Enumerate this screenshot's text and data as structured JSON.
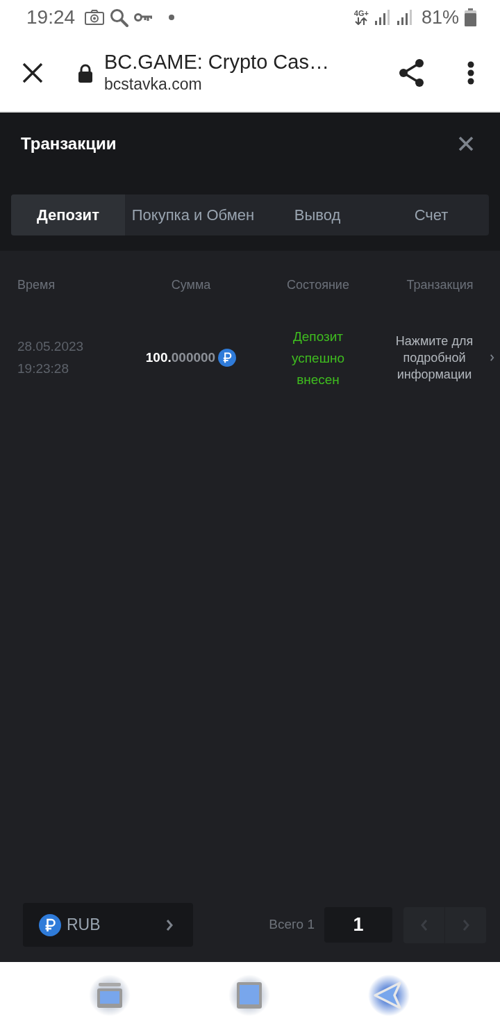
{
  "status_bar": {
    "time": "19:24",
    "network": "4G+",
    "battery": "81%"
  },
  "browser_bar": {
    "title": "BC.GAME: Crypto Cas…",
    "url": "bcstavka.com"
  },
  "dialog": {
    "title": "Транзакции",
    "tabs": [
      {
        "label": "Депозит",
        "selected": true
      },
      {
        "label": "Покупка и Обмен",
        "selected": false
      },
      {
        "label": "Вывод",
        "selected": false
      },
      {
        "label": "Счет",
        "selected": false
      }
    ],
    "table": {
      "columns": [
        "Время",
        "Сумма",
        "Состояние",
        "Транзакция"
      ],
      "rows": [
        {
          "date": "28.05.2023",
          "time": "19:23:28",
          "amount": "100.000000",
          "status": "Депозит успешно внесен",
          "succeeded": true,
          "details": "Нажмите для подробной информации"
        }
      ]
    },
    "footer": {
      "currency": "RUB",
      "total": "Всего 1",
      "page": "1",
      "prev": {
        "disabled": true
      },
      "next": {
        "disabled": true
      }
    }
  }
}
